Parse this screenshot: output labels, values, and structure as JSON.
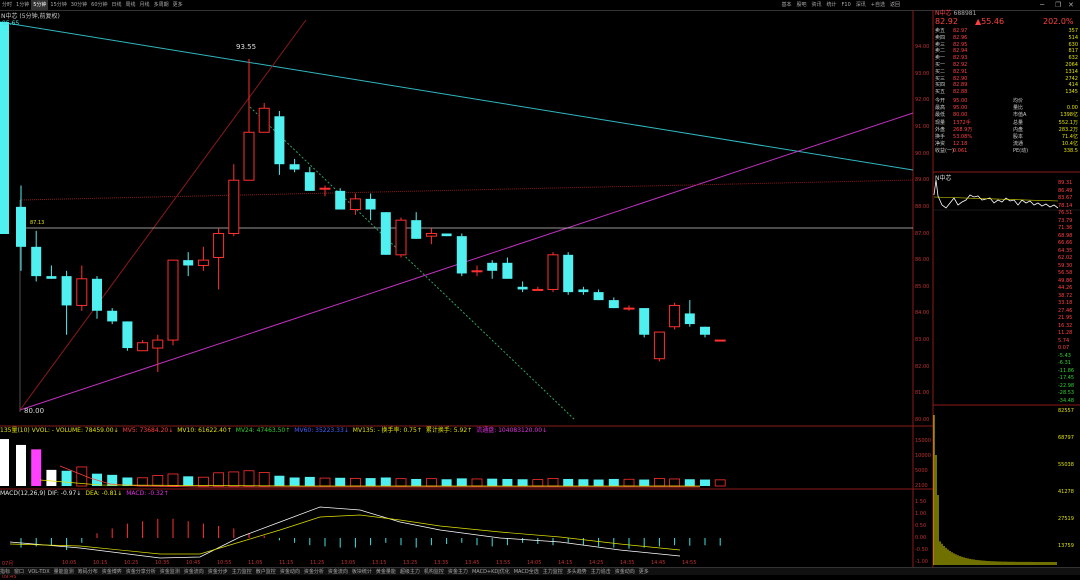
{
  "toolbar": {
    "periods": [
      "分时",
      "1分钟",
      "5分钟",
      "15分钟",
      "30分钟",
      "60分钟",
      "日线",
      "周线",
      "月线",
      "多周期",
      "更多"
    ],
    "active_period": "5分钟",
    "tools": [
      "基本",
      "股吧",
      "资讯",
      "统计",
      "F10",
      "深讯",
      "+自选",
      "返回"
    ]
  },
  "chart_info": {
    "name": "N中芯",
    "period_text": "(5分钟,前复权)",
    "high_label": "93.55",
    "low_label": "80.00",
    "left_top_label": "95.65",
    "marker_label": "87.13"
  },
  "price_axis": [
    "94.00",
    "93.00",
    "92.00",
    "91.00",
    "90.00",
    "89.00",
    "88.00",
    "87.00",
    "86.00",
    "85.00",
    "84.00",
    "83.00",
    "82.00",
    "81.00",
    "80.00"
  ],
  "volume_axis": [
    "15000",
    "10000",
    "5000",
    "2100"
  ],
  "macd_axis": [
    "1.50",
    "1.00",
    "0.50",
    "0.00",
    "-0.50",
    "-1.00"
  ],
  "time_axis": [
    "07月16日09:45",
    "10:05",
    "10:15",
    "10:25",
    "10:35",
    "10:45",
    "10:55",
    "11:05",
    "11:15",
    "11:25",
    "13:05",
    "13:15",
    "13:25",
    "13:35",
    "13:45",
    "13:55",
    "14:05",
    "14:15",
    "14:25",
    "14:35",
    "14:45",
    "14:55"
  ],
  "volume_header": [
    {
      "text": "135量(10) VVOL: - VOLUME: 78459.00↓",
      "color": "#e0e000"
    },
    {
      "text": "MV5: 73684.20↓",
      "color": "#ff4040"
    },
    {
      "text": "MV10: 61622.40↑",
      "color": "#e0e000"
    },
    {
      "text": "MV24: 47463.50↑",
      "color": "#30d030"
    },
    {
      "text": "MV60: 35223.33↓",
      "color": "#4060ff"
    },
    {
      "text": "MV135: - 换手率: 0.75↑",
      "color": "#e0e000"
    },
    {
      "text": "累计换手: 5.92↑",
      "color": "#e0e000"
    },
    {
      "text": "流通盘: 104083120.00↓",
      "color": "#e030e0"
    }
  ],
  "macd_header": [
    {
      "text": "MACD(12,26,9) DIF: -0.97↓",
      "color": "#e0e0e0"
    },
    {
      "text": "DEA: -0.81↓",
      "color": "#e0e000"
    },
    {
      "text": "MACD: -0.32↑",
      "color": "#e030e0"
    }
  ],
  "quote": {
    "title": "N中芯",
    "code": "688981",
    "price": "82.92",
    "change": "▲55.46",
    "pct": "202.0%",
    "asks": [
      {
        "label": "卖五",
        "price": "82.97",
        "vol": "357"
      },
      {
        "label": "卖四",
        "price": "82.96",
        "vol": "514"
      },
      {
        "label": "卖三",
        "price": "82.95",
        "vol": "630"
      },
      {
        "label": "卖二",
        "price": "82.94",
        "vol": "817"
      },
      {
        "label": "卖一",
        "price": "82.93",
        "vol": "632"
      }
    ],
    "bids": [
      {
        "label": "买一",
        "price": "82.92",
        "vol": "2064"
      },
      {
        "label": "买二",
        "price": "82.91",
        "vol": "1314"
      },
      {
        "label": "买三",
        "price": "82.90",
        "vol": "2742"
      },
      {
        "label": "买四",
        "price": "82.89",
        "vol": "414"
      },
      {
        "label": "买五",
        "price": "82.88",
        "vol": "1345"
      }
    ],
    "stats": [
      {
        "l1": "今开",
        "v1": "95.00",
        "l2": "均价",
        "v2": "-"
      },
      {
        "l1": "最高",
        "v1": "95.00",
        "l2": "量比",
        "v2": "0.00"
      },
      {
        "l1": "最低",
        "v1": "80.00",
        "l2": "市值A",
        "v2": "1398亿"
      },
      {
        "l1": "现量",
        "v1": "1372手",
        "l2": "总量",
        "v2": "552.1万"
      },
      {
        "l1": "外盘",
        "v1": "268.9万",
        "l2": "内盘",
        "v2": "283.2万"
      },
      {
        "l1": "换手",
        "v1": "53.08%",
        "l2": "股本",
        "v2": "71.4亿"
      },
      {
        "l1": "净资",
        "v1": "12.18",
        "l2": "流通",
        "v2": "10.4亿"
      },
      {
        "l1": "收益(一)",
        "v1": "0.061",
        "l2": "PE(动)",
        "v2": "338.5"
      }
    ]
  },
  "mini_chart": {
    "title": "N中芯",
    "right_axis": [
      "89.31",
      "86.49",
      "83.67",
      "78.14",
      "76.51",
      "73.79",
      "71.36",
      "68.98",
      "66.66",
      "64.35",
      "62.02",
      "59.30",
      "56.58",
      "49.86",
      "44.26",
      "38.72",
      "33.18",
      "27.46",
      "21.95",
      "16.32",
      "11.28",
      "5.74",
      "0.07",
      "-5.43",
      "-6.31",
      "-11.86",
      "-17.45",
      "-22.98",
      "-28.53",
      "-34.48"
    ],
    "vol_axis": [
      "82557",
      "68797",
      "55038",
      "41278",
      "27519",
      "13759"
    ]
  },
  "bottom_tabs": [
    "指标",
    "窗口",
    "VOL-TDX",
    "量能监测",
    "筹码分布",
    "资金博弈",
    "资金分享分析",
    "资金监测",
    "资金流向",
    "资金分步",
    "主力监控",
    "散户监控",
    "资金动向",
    "资金分析",
    "资金流向",
    "板块统计",
    "黄金量能",
    "超级主力",
    "机构监控",
    "资金主力",
    "MACD+KDJ优化",
    "MACD全选",
    "主力监控",
    "多头趋势",
    "主力追击",
    "资金动向",
    "更多"
  ],
  "candles": [
    [
      88.0,
      88.8,
      85.6,
      86.5
    ],
    [
      86.5,
      87.1,
      85.2,
      85.4
    ],
    [
      85.4,
      85.8,
      85.3,
      85.3
    ],
    [
      85.4,
      85.6,
      83.2,
      84.3
    ],
    [
      84.3,
      85.8,
      84.1,
      85.3
    ],
    [
      85.3,
      85.4,
      83.8,
      84.1
    ],
    [
      84.1,
      84.2,
      83.6,
      83.7
    ],
    [
      83.7,
      83.7,
      82.6,
      82.7
    ],
    [
      82.6,
      83.0,
      82.6,
      82.9
    ],
    [
      82.7,
      83.2,
      81.8,
      83.0
    ],
    [
      83.0,
      86.0,
      82.8,
      86.0
    ],
    [
      86.0,
      86.3,
      85.4,
      85.8
    ],
    [
      85.8,
      86.5,
      85.6,
      86.0
    ],
    [
      86.1,
      87.2,
      84.9,
      87.0
    ],
    [
      87.0,
      89.6,
      86.9,
      89.0
    ],
    [
      89.0,
      93.55,
      89.0,
      90.8
    ],
    [
      90.8,
      91.9,
      90.8,
      91.7
    ],
    [
      91.4,
      91.6,
      89.2,
      89.6
    ],
    [
      89.6,
      89.8,
      89.3,
      89.4
    ],
    [
      89.3,
      89.5,
      88.6,
      88.6
    ],
    [
      88.7,
      88.8,
      88.4,
      88.7
    ],
    [
      88.6,
      88.7,
      87.9,
      87.9
    ],
    [
      87.9,
      88.5,
      87.7,
      88.3
    ],
    [
      88.3,
      88.5,
      87.5,
      87.9
    ],
    [
      87.8,
      87.8,
      86.2,
      86.2
    ],
    [
      86.2,
      87.6,
      86.1,
      87.5
    ],
    [
      87.5,
      87.8,
      86.8,
      86.8
    ],
    [
      86.9,
      87.2,
      86.6,
      87.0
    ],
    [
      87.0,
      87.0,
      86.9,
      86.9
    ],
    [
      86.9,
      87.0,
      85.4,
      85.5
    ],
    [
      85.6,
      85.8,
      85.4,
      85.6
    ],
    [
      85.9,
      86.0,
      85.3,
      85.6
    ],
    [
      85.9,
      86.1,
      85.3,
      85.3
    ],
    [
      85.0,
      85.2,
      84.8,
      84.9
    ],
    [
      84.9,
      85.0,
      84.9,
      84.9
    ],
    [
      84.9,
      86.3,
      84.8,
      86.2
    ],
    [
      86.2,
      86.3,
      84.7,
      84.8
    ],
    [
      84.9,
      85.0,
      84.7,
      84.8
    ],
    [
      84.8,
      84.9,
      84.5,
      84.5
    ],
    [
      84.5,
      84.6,
      84.2,
      84.2
    ],
    [
      84.2,
      84.3,
      84.1,
      84.2
    ],
    [
      84.2,
      84.2,
      83.1,
      83.2
    ],
    [
      82.3,
      83.3,
      82.2,
      83.3
    ],
    [
      83.5,
      84.4,
      83.4,
      84.3
    ],
    [
      84.0,
      84.5,
      83.5,
      83.6
    ],
    [
      83.5,
      83.5,
      83.1,
      83.2
    ],
    [
      83.0,
      83.0,
      83.0,
      83.0
    ]
  ]
}
